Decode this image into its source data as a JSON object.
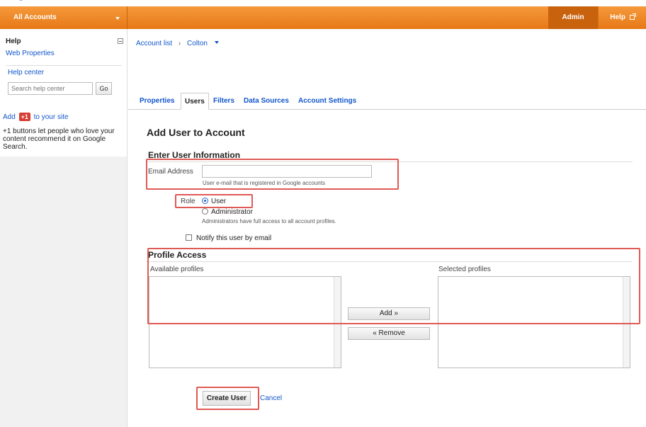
{
  "topbar": {
    "account_selector": "All Accounts",
    "admin": "Admin",
    "help": "Help"
  },
  "sidebar": {
    "help_title": "Help",
    "web_properties": "Web Properties",
    "help_center": "Help center",
    "search_placeholder": "Search help center",
    "go": "Go",
    "add_prefix": "Add",
    "plus_one": "+1",
    "add_suffix": "to your site",
    "description": "+1 buttons let people who love your content recommend it on Google Search."
  },
  "breadcrumb": {
    "account_list": "Account list",
    "current": "Colton"
  },
  "tabs": [
    {
      "label": "Properties"
    },
    {
      "label": "Users"
    },
    {
      "label": "Filters"
    },
    {
      "label": "Data Sources"
    },
    {
      "label": "Account Settings"
    }
  ],
  "form": {
    "page_title": "Add User to Account",
    "user_info_title": "Enter User Information",
    "email_label": "Email Address",
    "email_value": "",
    "email_hint": "User e-mail that is registered in Google accounts",
    "role_label": "Role",
    "role_user": "User",
    "role_admin": "Administrator",
    "role_selected": "User",
    "admin_hint": "Administrators have full access to all account profiles.",
    "notify_label": "Notify this user by email",
    "profile_access_title": "Profile Access",
    "available_profiles": "Available profiles",
    "selected_profiles": "Selected profiles",
    "add_button": "Add »",
    "remove_button": "« Remove",
    "create_button": "Create User",
    "cancel": "Cancel"
  },
  "colors": {
    "topbar_orange": "#f08a24",
    "admin_dark_orange": "#c9620d",
    "link_blue": "#1155cc",
    "highlight_red": "#e05a55"
  }
}
